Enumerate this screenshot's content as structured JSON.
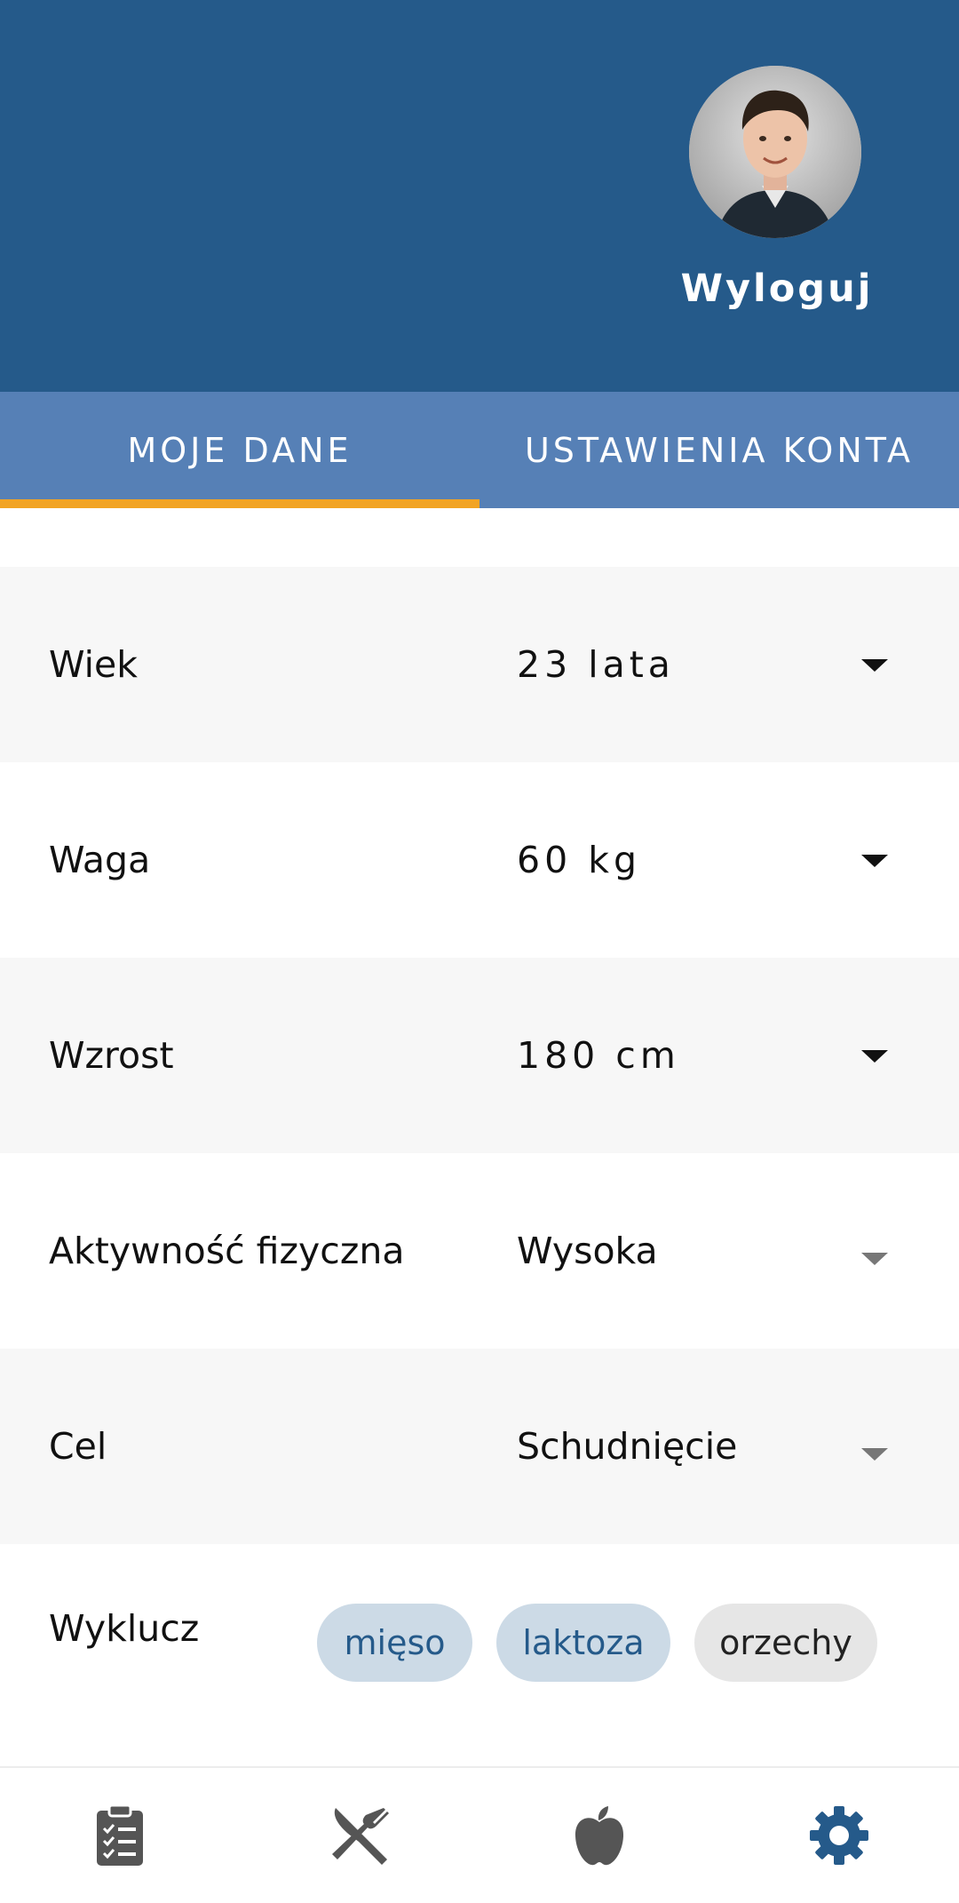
{
  "header": {
    "logout_label": "Wyloguj",
    "background_color": "#255a8a"
  },
  "tabs": [
    {
      "label": "MOJE DANE",
      "active": true
    },
    {
      "label": "USTAWIENIA KONTA",
      "active": false
    }
  ],
  "tab_indicator_color": "#f2a424",
  "fields": [
    {
      "label": "Wiek",
      "value": "23 lata"
    },
    {
      "label": "Waga",
      "value": "60 kg"
    },
    {
      "label": "Wzrost",
      "value": "180 cm"
    },
    {
      "label": "Aktywność fizyczna",
      "value": "Wysoka"
    },
    {
      "label": "Cel",
      "value": "Schudnięcie"
    }
  ],
  "exclude": {
    "label": "Wyklucz",
    "chips": [
      {
        "label": "mięso",
        "selected": true
      },
      {
        "label": "laktoza",
        "selected": true
      },
      {
        "label": "orzechy",
        "selected": false
      }
    ]
  },
  "bottom_nav": [
    {
      "icon": "clipboard-icon",
      "active": false
    },
    {
      "icon": "fork-knife-icon",
      "active": false
    },
    {
      "icon": "apple-icon",
      "active": false
    },
    {
      "icon": "gear-icon",
      "active": true
    }
  ],
  "colors": {
    "nav_active": "#255a8a",
    "nav_inactive": "#555555",
    "chip_selected_bg": "#ccdae6",
    "chip_unselected_bg": "#e6e6e6"
  }
}
